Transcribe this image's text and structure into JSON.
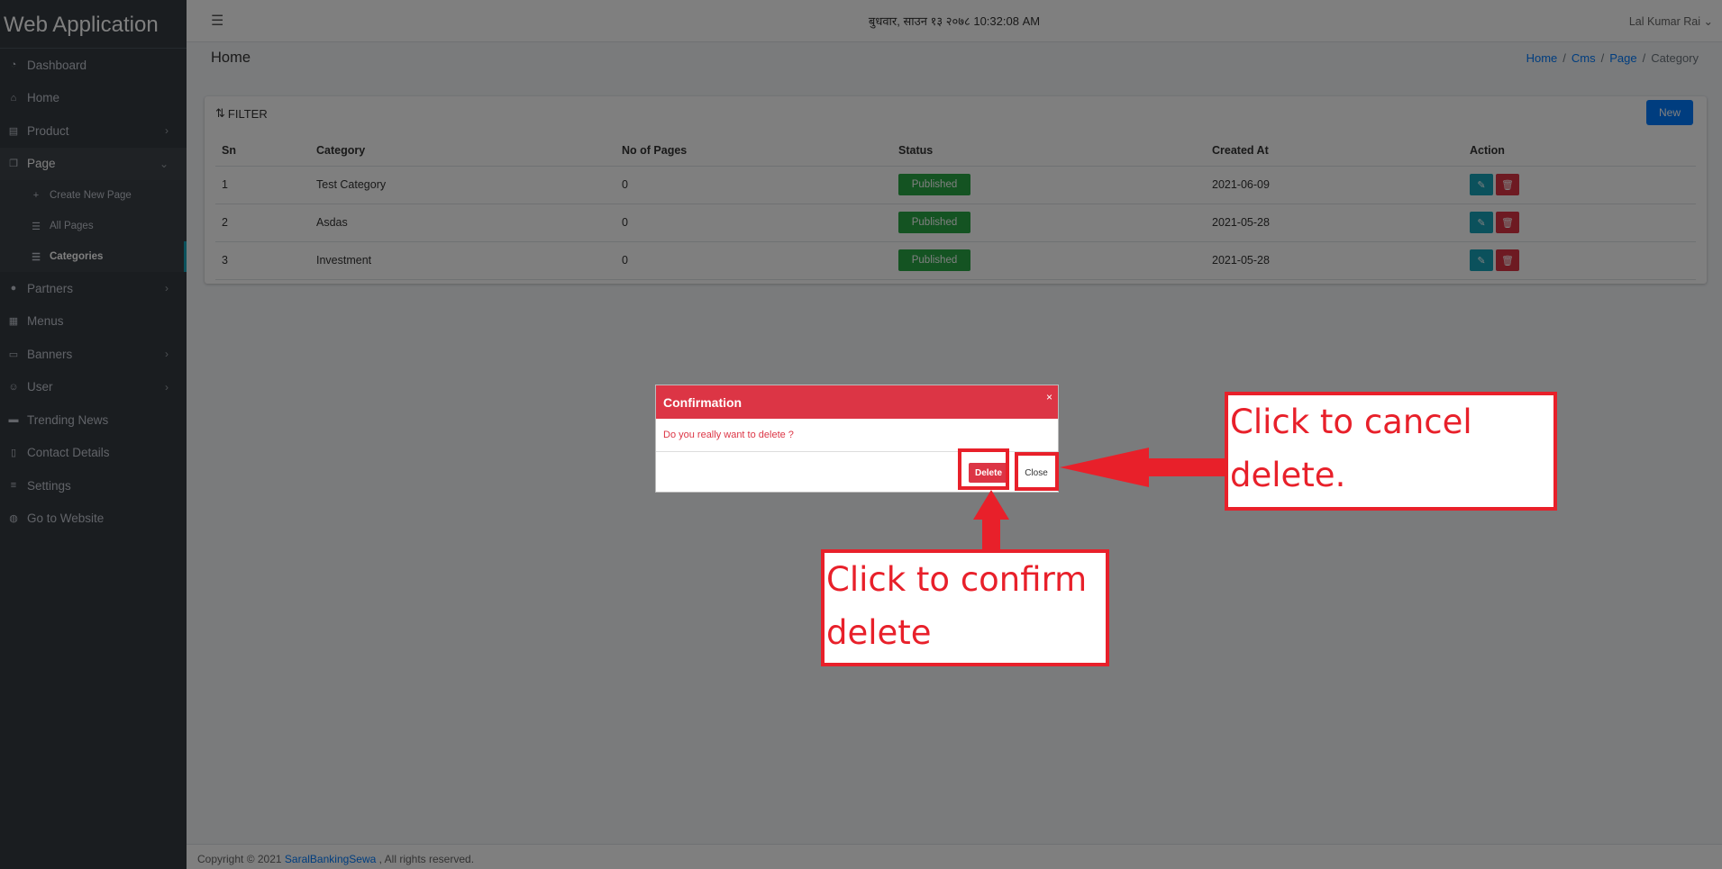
{
  "app": {
    "title": "Web Application"
  },
  "sidebar": {
    "items": [
      {
        "label": "Dashboard",
        "icon": "dashboard-icon"
      },
      {
        "label": "Home",
        "icon": "home-icon"
      },
      {
        "label": "Product",
        "icon": "product-icon"
      },
      {
        "label": "Page",
        "icon": "page-icon"
      },
      {
        "label": "Partners",
        "icon": "partners-icon"
      },
      {
        "label": "Menus",
        "icon": "menus-icon"
      },
      {
        "label": "Banners",
        "icon": "banners-icon"
      },
      {
        "label": "User",
        "icon": "user-icon"
      },
      {
        "label": "Trending News",
        "icon": "news-icon"
      },
      {
        "label": "Contact Details",
        "icon": "contact-icon"
      },
      {
        "label": "Settings",
        "icon": "settings-icon"
      },
      {
        "label": "Go to Website",
        "icon": "globe-icon"
      }
    ],
    "page_sub": [
      {
        "label": "Create New Page"
      },
      {
        "label": "All Pages"
      },
      {
        "label": "Categories"
      }
    ]
  },
  "topbar": {
    "datetime": "बुधवार, साउन १३ २०७८ 10:32:08 AM",
    "user": "Lal Kumar Rai"
  },
  "header": {
    "title": "Home",
    "breadcrumb": [
      "Home",
      "Cms",
      "Page",
      "Category"
    ]
  },
  "card": {
    "filter_label": "FILTER",
    "new_label": "New",
    "columns": [
      "Sn",
      "Category",
      "No of Pages",
      "Status",
      "Created At",
      "Action"
    ],
    "rows": [
      {
        "sn": "1",
        "category": "Test Category",
        "pages": "0",
        "status": "Published",
        "created": "2021-06-09"
      },
      {
        "sn": "2",
        "category": "Asdas",
        "pages": "0",
        "status": "Published",
        "created": "2021-05-28"
      },
      {
        "sn": "3",
        "category": "Investment",
        "pages": "0",
        "status": "Published",
        "created": "2021-05-28"
      }
    ]
  },
  "footer": {
    "prefix": "Copyright © 2021",
    "link": "SaralBankingSewa",
    "suffix": ", All rights reserved."
  },
  "modal": {
    "title": "Confirmation",
    "message": "Do you really want to delete ?",
    "delete_label": "Delete",
    "close_label": "Close"
  },
  "annotations": {
    "cancel_line1": "Click to cancel",
    "cancel_line2": "delete.",
    "confirm_line1": "Click to confirm",
    "confirm_line2": "delete"
  },
  "colors": {
    "danger": "#dc3545",
    "success": "#28a745",
    "info": "#17a2b8",
    "primary": "#007bff",
    "annotation": "#e8202a",
    "sidebar": "#343a40"
  }
}
